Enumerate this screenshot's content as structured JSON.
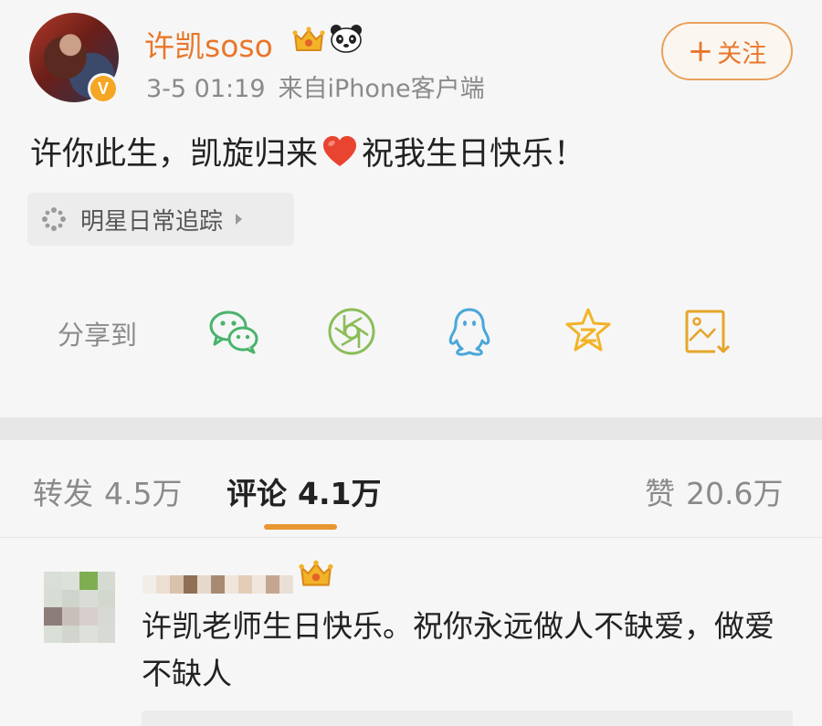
{
  "post": {
    "username": "许凯soso",
    "verified_badge": "V",
    "badges": [
      "crown-icon",
      "panda-icon"
    ],
    "time": "3-5 01:19",
    "source": "来自iPhone客户端",
    "follow_label": "关注",
    "text_before": "许你此生，凯旋归来",
    "text_after": "祝我生日快乐！",
    "topic": "明星日常追踪"
  },
  "share": {
    "label": "分享到",
    "targets": [
      "wechat-icon",
      "moments-icon",
      "qq-icon",
      "qzone-icon",
      "save-image-icon"
    ]
  },
  "stats": {
    "repost_label": "转发",
    "repost_count": "4.5万",
    "comment_label": "评论",
    "comment_count": "4.1万",
    "like_label": "赞",
    "like_count": "20.6万",
    "active_tab": "comment"
  },
  "comment": {
    "text": "许凯老师生日快乐。祝你永远做人不缺爱，做爱不缺人"
  },
  "colors": {
    "accent": "#e8772b",
    "underline": "#e8962f",
    "wechat": "#4ab36d",
    "moments": "#8bbd5a",
    "qq": "#4aa7d8",
    "qzone": "#f2b328",
    "heart": "#e8442f"
  }
}
